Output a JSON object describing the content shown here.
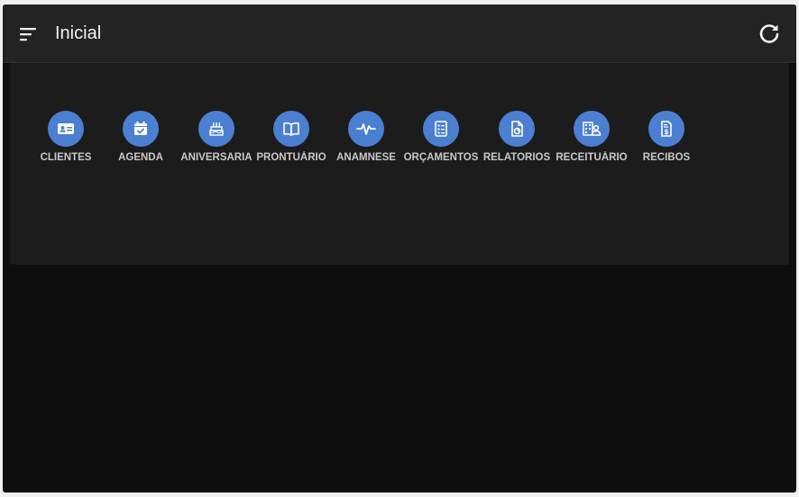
{
  "header": {
    "title": "Inicial"
  },
  "shortcuts": [
    {
      "label": "CLIENTES",
      "icon": "id-card-icon"
    },
    {
      "label": "AGENDA",
      "icon": "calendar-check-icon"
    },
    {
      "label": "ANIVERSARIA",
      "icon": "birthday-cake-icon"
    },
    {
      "label": "PRONTUÁRIO",
      "icon": "book-open-icon"
    },
    {
      "label": "ANAMNESE",
      "icon": "heartbeat-icon"
    },
    {
      "label": "ORÇAMENTOS",
      "icon": "checklist-icon"
    },
    {
      "label": "RELATORIOS",
      "icon": "report-chart-icon"
    },
    {
      "label": "RECEITUÁRIO",
      "icon": "prescription-icon"
    },
    {
      "label": "RECIBOS",
      "icon": "receipt-dollar-icon"
    }
  ],
  "colors": {
    "accent": "#4b7fd1",
    "topbar": "#232323",
    "panel": "#1c1c1c",
    "background": "#0e0e0e"
  }
}
